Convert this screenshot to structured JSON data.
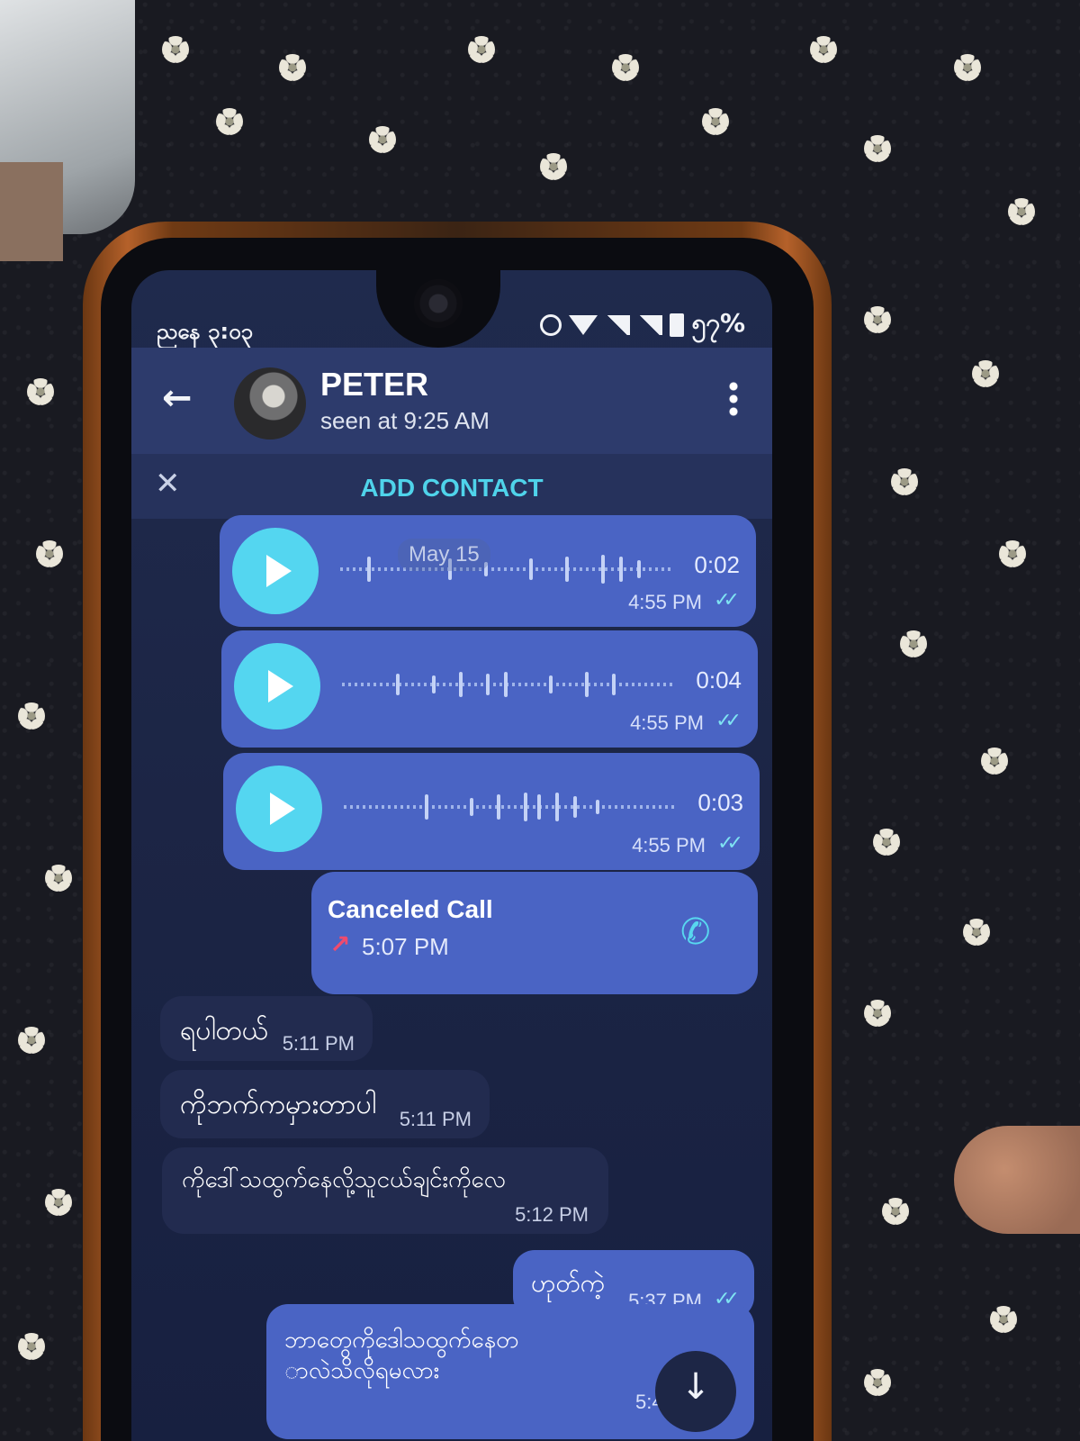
{
  "status_bar": {
    "time": "ညနေ ၃:၀၃",
    "battery": "၅၇%"
  },
  "header": {
    "contact_name": "PETER",
    "contact_status": "seen at 9:25 AM"
  },
  "banner": {
    "add_contact_label": "ADD CONTACT"
  },
  "date_chip": "May 15",
  "voice_messages": [
    {
      "duration": "0:02",
      "time": "4:55 PM",
      "read": true
    },
    {
      "duration": "0:04",
      "time": "4:55 PM",
      "read": true
    },
    {
      "duration": "0:03",
      "time": "4:55 PM",
      "read": true
    }
  ],
  "call": {
    "title": "Canceled Call",
    "time": "5:07 PM",
    "arrow_color": "#ef4b6e"
  },
  "incoming_messages": [
    {
      "text": "ရပါတယ်",
      "time": "5:11 PM"
    },
    {
      "text": "ကိုဘက်ကမှားတာပါ",
      "time": "5:11 PM"
    },
    {
      "text": "ကိုဒေါ်သထွက်နေလို့သူငယ်ချင်းကိုလေ",
      "time": "5:12 PM"
    }
  ],
  "outgoing_messages": [
    {
      "text": "ဟုတ်ကဲ့",
      "time": "5:37 PM",
      "read": true
    },
    {
      "line1": "ဘာတွေကိုဒေါသထွက်နေတ",
      "line2": "ာလဲသိလိုရမလား",
      "time": "5:4"
    }
  ],
  "colors": {
    "accent": "#54d6f0",
    "outgoing_bubble": "#4a64c4",
    "incoming_bubble": "#222b4f",
    "header": "#2d3b6c"
  },
  "icons": [
    "back-arrow-icon",
    "avatar",
    "more-vertical-icon",
    "close-icon",
    "play-icon",
    "double-check-icon",
    "call-arrow-icon",
    "phone-icon",
    "arrow-down-icon"
  ]
}
